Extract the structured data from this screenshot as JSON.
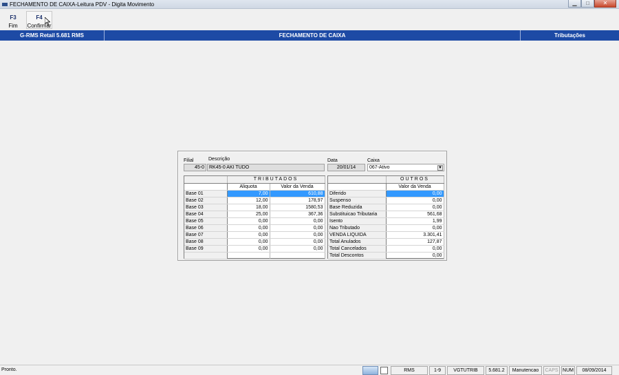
{
  "window": {
    "title": "FECHAMENTO DE CAIXA-Leitura PDV - Digita Movimento",
    "min_glyph": "▁",
    "max_glyph": "□",
    "close_glyph": "✕"
  },
  "toolbar": {
    "f3_key": "F3",
    "f3_label": "Fim",
    "f4_key": "F4",
    "f4_label": "Confirmar"
  },
  "header": {
    "left": "G-RMS Retail 5.681 RMS",
    "center": "FECHAMENTO DE CAIXA",
    "right": "Tributações"
  },
  "form": {
    "filial_label": "Filial",
    "filial_value": "45-0",
    "descricao_label": "Descrição",
    "descricao_value": "RK45-0 AKI TUDO",
    "data_label": "Data",
    "data_value": "20/01/14",
    "caixa_label": "Caixa",
    "caixa_value": "067-Ativo"
  },
  "tributados": {
    "title": "TRIBUTADOS",
    "col_aliquota": "Aliquota",
    "col_valor": "Valor da Venda",
    "rows": [
      {
        "label": "Base 01",
        "aliquota": "7,00",
        "valor": "610,88"
      },
      {
        "label": "Base 02",
        "aliquota": "12,00",
        "valor": "178,97"
      },
      {
        "label": "Base 03",
        "aliquota": "18,00",
        "valor": "1580,53"
      },
      {
        "label": "Base 04",
        "aliquota": "25,00",
        "valor": "367,36"
      },
      {
        "label": "Base 05",
        "aliquota": "0,00",
        "valor": "0,00"
      },
      {
        "label": "Base 06",
        "aliquota": "0,00",
        "valor": "0,00"
      },
      {
        "label": "Base 07",
        "aliquota": "0,00",
        "valor": "0,00"
      },
      {
        "label": "Base 08",
        "aliquota": "0,00",
        "valor": "0,00"
      },
      {
        "label": "Base 09",
        "aliquota": "0,00",
        "valor": "0,00"
      }
    ]
  },
  "outros": {
    "title": "OUTROS",
    "col_valor": "Valor da Venda",
    "rows": [
      {
        "label": "Diferido",
        "valor": "0,00"
      },
      {
        "label": "Suspenso",
        "valor": "0,00"
      },
      {
        "label": "Base Reduzida",
        "valor": "0,00"
      },
      {
        "label": "Substituicao Tributaria",
        "valor": "561,68"
      },
      {
        "label": "Isento",
        "valor": "1,99"
      },
      {
        "label": "Nao Tributado",
        "valor": "0,00"
      },
      {
        "label": "VENDA LIQUIDA",
        "valor": "3.301,41"
      },
      {
        "label": "Total Anulados",
        "valor": "127,87"
      },
      {
        "label": "Total Cancelados",
        "valor": "0,00"
      },
      {
        "label": "Total Descontos",
        "valor": "0,00"
      }
    ]
  },
  "status": {
    "text": "Pronto.",
    "rms": "RMS",
    "range": "1-9",
    "module": "VGTUTRIB",
    "version": "5.681.2",
    "mode": "Manutencao",
    "caps": "CAPS",
    "num": "NUM",
    "date": "08/09/2014"
  },
  "colors": {
    "header_blue": "#1d4aa5",
    "selection_blue": "#3399ff"
  }
}
